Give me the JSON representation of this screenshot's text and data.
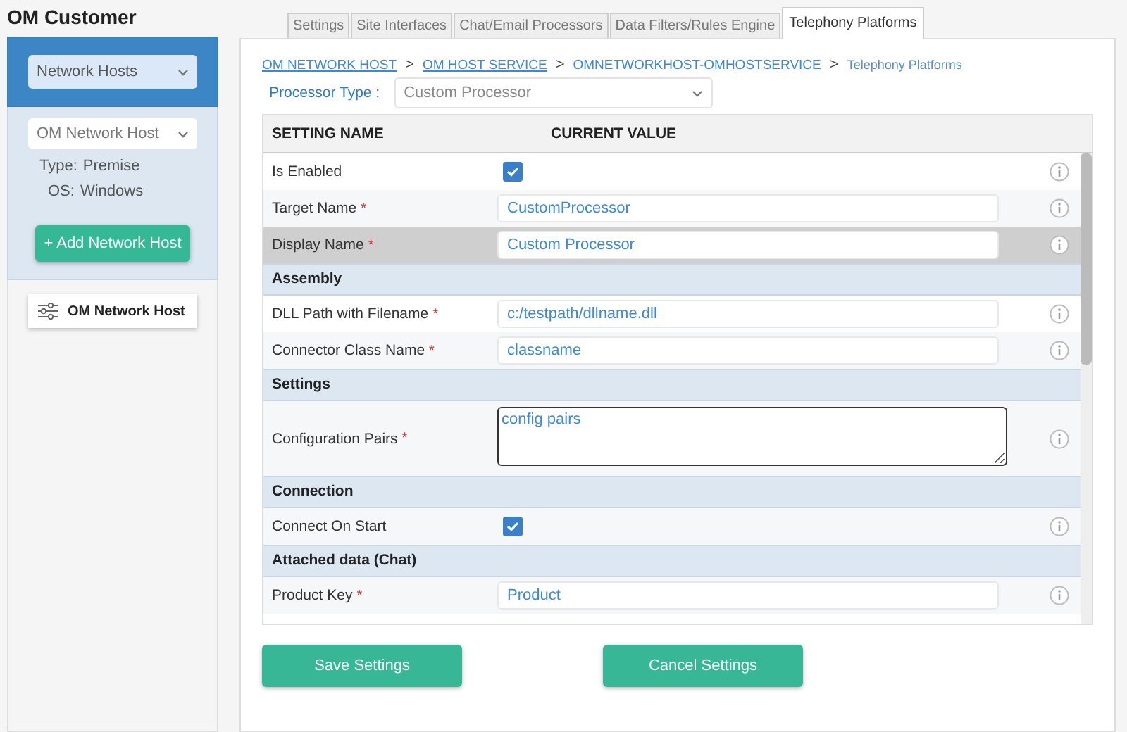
{
  "app_title": "OM Customer",
  "sidebar": {
    "host_type_select": "Network Hosts",
    "host_select": "OM Network Host",
    "type_label": "Type:",
    "type_value": "Premise",
    "os_label": "OS:",
    "os_value": "Windows",
    "add_button": "+ Add Network Host",
    "host_item": {
      "label": "OM Network Host",
      "selected": true
    }
  },
  "tabs": [
    {
      "label": "Settings",
      "selected": false
    },
    {
      "label": "Site Interfaces",
      "selected": false
    },
    {
      "label": "Chat/Email Processors",
      "selected": false
    },
    {
      "label": "Data Filters/Rules Engine",
      "selected": false
    },
    {
      "label": "Telephony Platforms",
      "selected": true
    }
  ],
  "breadcrumb": [
    {
      "label": "OM NETWORK HOST",
      "kind": "link"
    },
    {
      "label": "OM HOST SERVICE",
      "kind": "link"
    },
    {
      "label": "OMNETWORKHOST-OMHOSTSERVICE",
      "kind": "plain"
    },
    {
      "label": "Telephony Platforms",
      "kind": "current"
    }
  ],
  "breadcrumb_separator": ">",
  "processor_type": {
    "label": "Processor Type :",
    "value": "Custom Processor"
  },
  "table": {
    "columns": [
      "SETTING NAME",
      "CURRENT VALUE"
    ],
    "rows": [
      {
        "kind": "checkbox",
        "name": "Is Enabled",
        "required": false,
        "checked": true,
        "selected": false
      },
      {
        "kind": "text",
        "name": "Target Name",
        "required": true,
        "value": "CustomProcessor",
        "selected": false
      },
      {
        "kind": "text",
        "name": "Display Name",
        "required": true,
        "value": "Custom Processor",
        "selected": true
      },
      {
        "kind": "section",
        "name": "Assembly"
      },
      {
        "kind": "text",
        "name": "DLL Path with Filename",
        "required": true,
        "value": "c:/testpath/dllname.dll",
        "selected": false
      },
      {
        "kind": "text",
        "name": "Connector Class Name",
        "required": true,
        "value": "classname",
        "selected": false
      },
      {
        "kind": "section",
        "name": "Settings"
      },
      {
        "kind": "textarea",
        "name": "Configuration Pairs",
        "required": true,
        "value": "config pairs",
        "selected": false
      },
      {
        "kind": "section",
        "name": "Connection"
      },
      {
        "kind": "checkbox",
        "name": "Connect On Start",
        "required": false,
        "checked": true,
        "selected": false
      },
      {
        "kind": "section",
        "name": "Attached data (Chat)"
      },
      {
        "kind": "text",
        "name": "Product Key",
        "required": true,
        "value": "Product",
        "selected": false
      }
    ]
  },
  "required_mark": "*",
  "buttons": [
    "Save Settings",
    "Cancel Settings"
  ]
}
